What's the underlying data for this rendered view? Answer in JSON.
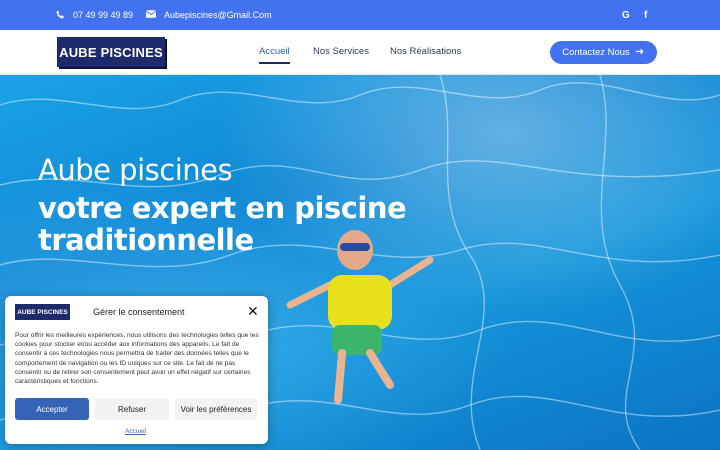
{
  "topbar": {
    "phone": "07 49 99 49 89",
    "email": "Aubepiscines@Gmail.Com",
    "social": [
      "google-icon",
      "facebook-icon"
    ]
  },
  "header": {
    "logo_text": "AUBE PISCINES",
    "nav": [
      {
        "label": "Accueil",
        "active": true
      },
      {
        "label": "Nos Services",
        "active": false
      },
      {
        "label": "Nos Réalisations",
        "active": false
      }
    ],
    "contact_label": "Contactez Nous",
    "contact_icon": "arrow-right-icon"
  },
  "hero": {
    "line1": "Aube piscines",
    "line2": "votre expert en piscine",
    "line3": "traditionnelle"
  },
  "consent": {
    "logo_text": "AUBE PISCINES",
    "title": "Gérer le consentement",
    "body": "Pour offrir les meilleures expériences, nous utilisons des technologies telles que les cookies pour stocker et/ou accéder aux informations des appareils. Le fait de consentir à ces technologies nous permettra de traiter des données telles que le comportement de navigation ou les ID uniques sur ce site. Le fait de ne pas consentir ou de retirer son consentement peut avoir un effet négatif sur certaines caractéristiques et fonctions.",
    "accept_label": "Accepter",
    "refuse_label": "Refuser",
    "prefs_label": "Voir les préférences",
    "link_label": "Accueil"
  },
  "colors": {
    "accent": "#4272f0",
    "brand_dark": "#1d2a6b",
    "accept_button": "#3463b8"
  }
}
